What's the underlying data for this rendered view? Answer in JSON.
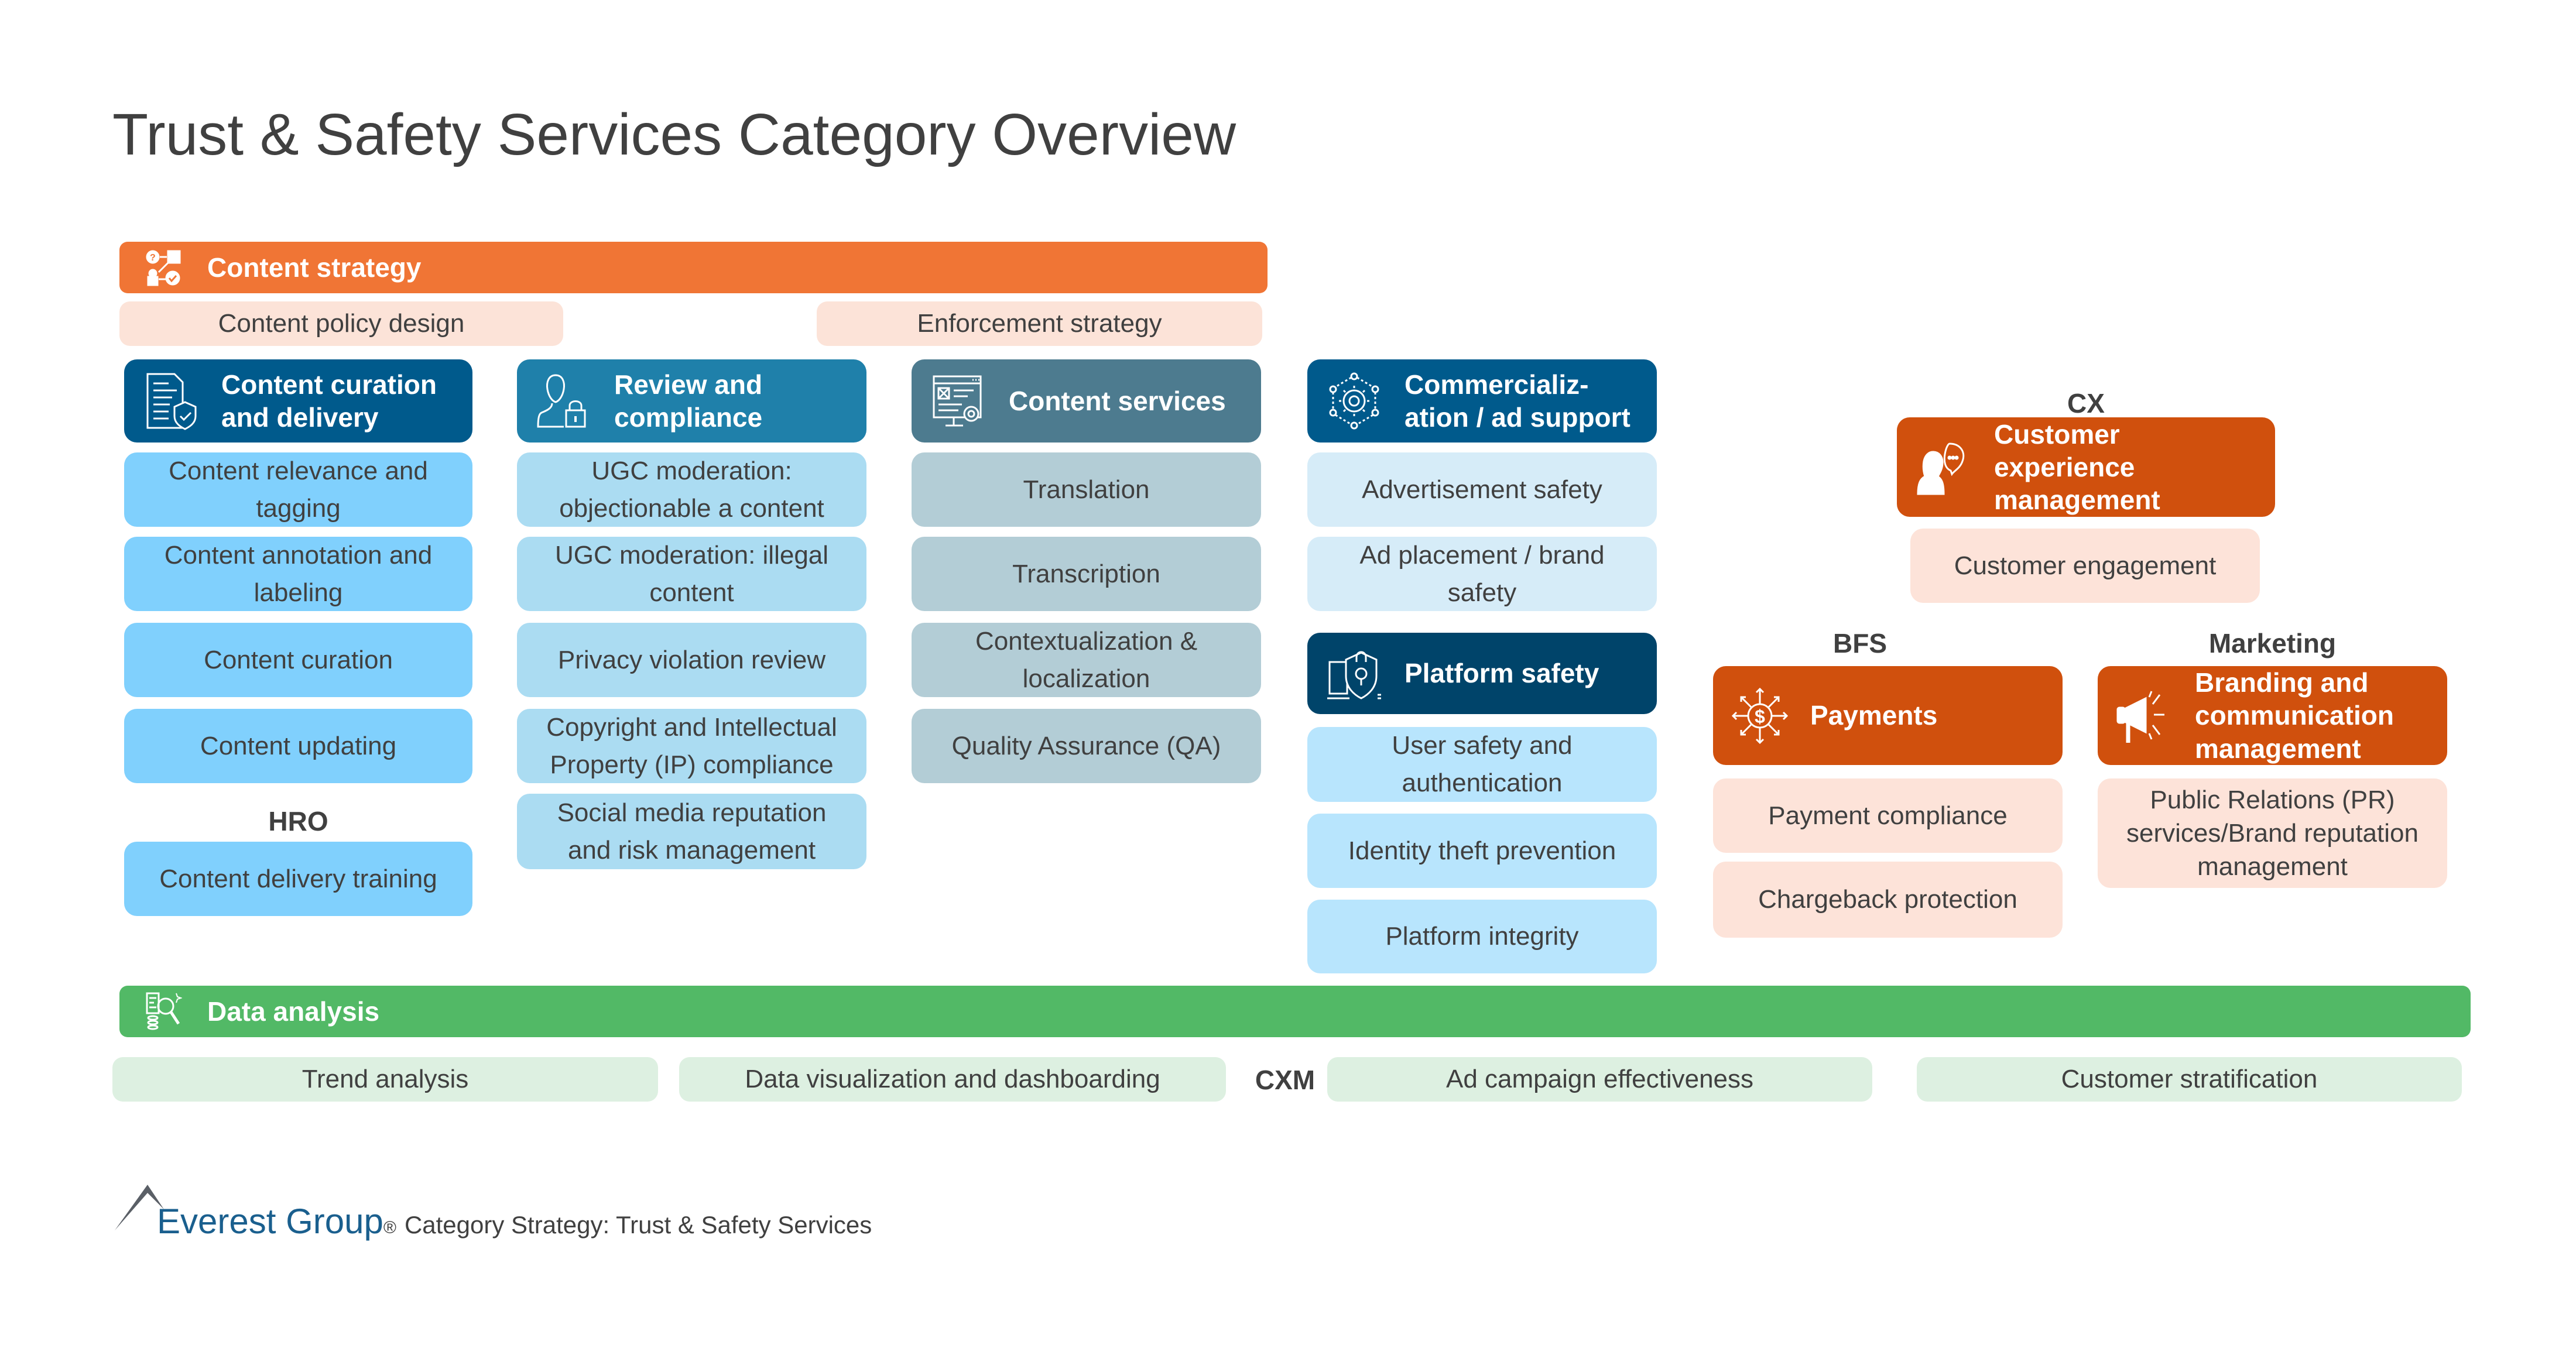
{
  "title": "Trust & Safety Services Category Overview",
  "content_strategy": {
    "label": "Content strategy",
    "icon": "strategy-flow-icon",
    "sub_items": [
      "Content policy design",
      "Enforcement strategy"
    ]
  },
  "columns": [
    {
      "header": "Content curation and delivery",
      "icon": "document-shield-icon",
      "items": [
        "Content relevance and tagging",
        "Content annotation and labeling",
        "Content curation",
        "Content updating"
      ],
      "group_label": "HRO",
      "group_items": [
        "Content delivery training"
      ]
    },
    {
      "header": "Review and compliance",
      "icon": "user-lock-icon",
      "items": [
        "UGC moderation: objectionable a content",
        "UGC moderation: illegal content",
        "Privacy violation review",
        "Copyright and Intellectual Property (IP) compliance",
        "Social media reputation and risk management"
      ]
    },
    {
      "header": "Content services",
      "icon": "monitor-gear-icon",
      "items": [
        "Translation",
        "Transcription",
        "Contextualization & localization",
        "Quality Assurance (QA)"
      ]
    },
    {
      "header": "Commercializ-ation / ad support",
      "icon": "gear-network-icon",
      "items": [
        "Advertisement safety",
        "Ad placement / brand safety"
      ]
    },
    {
      "header": "Platform safety",
      "icon": "device-shield-lock-icon",
      "items": [
        "User safety and authentication",
        "Identity theft prevention",
        "Platform integrity"
      ]
    }
  ],
  "cx": {
    "group_label": "CX",
    "header": "Customer experience management",
    "icon": "agent-chat-icon",
    "items": [
      "Customer engagement"
    ]
  },
  "bfs": {
    "group_label": "BFS",
    "header": "Payments",
    "icon": "dollar-arrows-icon",
    "items": [
      "Payment compliance",
      "Chargeback protection"
    ]
  },
  "marketing": {
    "group_label": "Marketing",
    "header": "Branding and communication management",
    "icon": "megaphone-icon",
    "items": [
      "Public Relations (PR) services/Brand reputation management"
    ]
  },
  "data_analysis": {
    "label": "Data analysis",
    "icon": "data-magnifier-icon",
    "items": [
      "Trend analysis",
      "Data visualization and dashboarding",
      "Ad campaign effectiveness",
      "Customer stratification"
    ],
    "cxm_label": "CXM"
  },
  "footer": {
    "brand": "Everest Group",
    "registered": "®",
    "text": "Category Strategy: Trust & Safety Services"
  },
  "colors": {
    "content_strategy": "#f07535",
    "data_analysis": "#52b966",
    "curation_header": "#005a8c",
    "review_header": "#1f80aa",
    "services_header": "#4d7b8f",
    "platform_header": "#00446a",
    "industry_header": "#d0500d"
  }
}
